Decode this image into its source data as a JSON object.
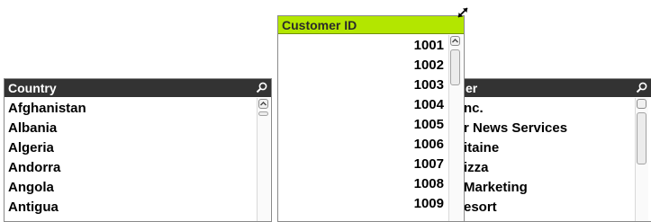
{
  "country_listbox": {
    "title": "Country",
    "items": [
      "Afghanistan",
      "Albania",
      "Algeria",
      "Andorra",
      "Angola",
      "Antigua"
    ],
    "icons": {
      "search": "search-icon",
      "scroll_up": "scroll-up-arrow-icon"
    },
    "header_color": "#333333"
  },
  "customer_listbox": {
    "title": "er",
    "items": [
      "nc.",
      "r News Services",
      "itaine",
      "izza",
      "Marketing",
      "esort"
    ],
    "icons": {
      "search": "search-icon"
    },
    "header_color": "#333333"
  },
  "customer_id_listbox": {
    "title": "Customer ID",
    "items": [
      "1001",
      "1002",
      "1003",
      "1004",
      "1005",
      "1006",
      "1007",
      "1008",
      "1009"
    ],
    "icons": {
      "resize": "resize-diagonal-icon",
      "scroll_up": "scroll-up-arrow-icon"
    },
    "header_color": "#b3e600"
  }
}
